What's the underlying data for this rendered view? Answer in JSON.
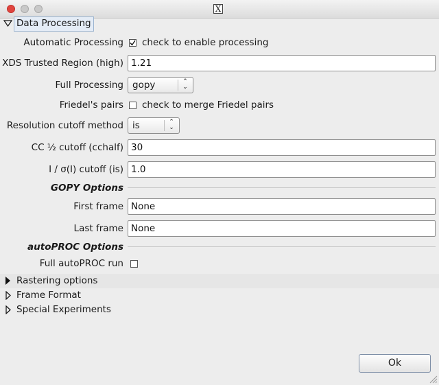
{
  "window": {
    "title_icon": "x11-icon",
    "title_glyph": "X"
  },
  "data_processing": {
    "header": "Data Processing",
    "automatic_processing": {
      "label": "Automatic Processing",
      "checked": true,
      "checkbox_text": "check to enable processing"
    },
    "xds_trusted_region": {
      "label": "XDS Trusted Region (high)",
      "value": "1.21"
    },
    "full_processing": {
      "label": "Full Processing",
      "value": "gopy"
    },
    "friedels_pairs": {
      "label": "Friedel's pairs",
      "checked": false,
      "checkbox_text": "check to merge Friedel pairs"
    },
    "resolution_cutoff": {
      "label": "Resolution cutoff method",
      "value": "is"
    },
    "cc_half_cutoff": {
      "label": "CC ½ cutoff (cchalf)",
      "value": "30"
    },
    "i_sigma_cutoff": {
      "label": "I / σ(I) cutoff (is)",
      "value": "1.0"
    },
    "gopy_options": {
      "title": "GOPY Options",
      "first_frame": {
        "label": "First frame",
        "value": "None"
      },
      "last_frame": {
        "label": "Last frame",
        "value": "None"
      }
    },
    "autoproc_options": {
      "title": "autoPROC Options",
      "full_autoproc_run": {
        "label": "Full autoPROC run",
        "checked": false
      }
    }
  },
  "collapsed_sections": [
    {
      "label": "Rastering options"
    },
    {
      "label": "Frame Format"
    },
    {
      "label": "Special Experiments"
    }
  ],
  "buttons": {
    "ok": "Ok"
  },
  "colors": {
    "close": "#e0443e",
    "header_highlight": "#e4ecf6",
    "background": "#ededed"
  }
}
